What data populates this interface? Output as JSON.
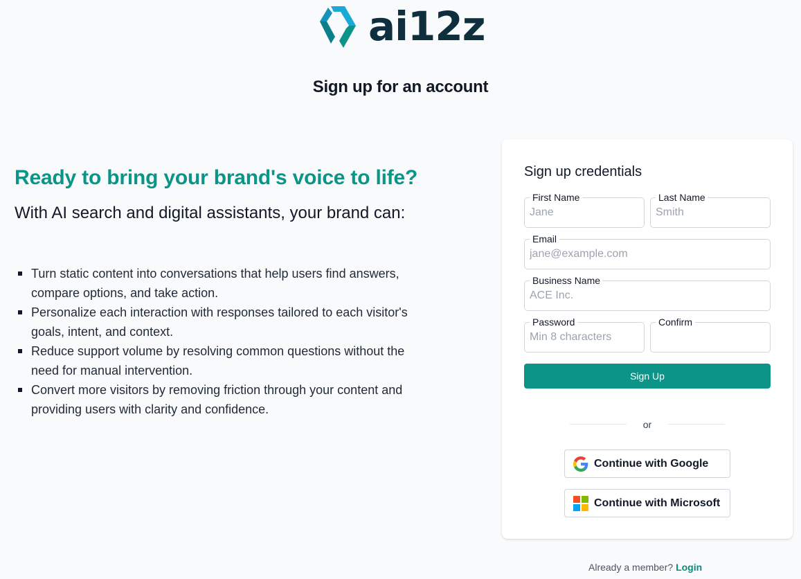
{
  "brand": {
    "name": "ai12z",
    "colors": {
      "teal": "#0d9488",
      "dark": "#0f2e3e",
      "accent": "#1ba9d6"
    }
  },
  "page_title": "Sign up for an account",
  "hero": {
    "heading": "Ready to bring your brand's voice to life?",
    "subheading": "With AI search and digital assistants, your brand can:",
    "benefits": [
      "Turn static content into conversations that help users find answers, compare options, and take action.",
      "Personalize each interaction with responses tailored to each visitor's goals, intent, and context.",
      "Reduce support volume by resolving common questions without the need for manual intervention.",
      "Convert more visitors by removing friction through your content and providing users with clarity and confidence."
    ]
  },
  "form": {
    "title": "Sign up credentials",
    "first_name": {
      "label": "First Name",
      "placeholder": "Jane",
      "value": ""
    },
    "last_name": {
      "label": "Last Name",
      "placeholder": "Smith",
      "value": ""
    },
    "email": {
      "label": "Email",
      "placeholder": "jane@example.com",
      "value": ""
    },
    "business_name": {
      "label": "Business Name",
      "placeholder": "ACE Inc.",
      "value": ""
    },
    "password": {
      "label": "Password",
      "placeholder": "Min 8 characters",
      "value": ""
    },
    "confirm": {
      "label": "Confirm",
      "placeholder": "",
      "value": ""
    },
    "submit_label": "Sign Up",
    "or_text": "or",
    "google_label": "Continue with Google",
    "microsoft_label": "Continue with Microsoft"
  },
  "footer": {
    "prompt": "Already a member?",
    "login_label": "Login"
  },
  "icons": {
    "logo": "ai12z-logo-mark",
    "google": "google-g-icon",
    "microsoft": "microsoft-icon"
  }
}
